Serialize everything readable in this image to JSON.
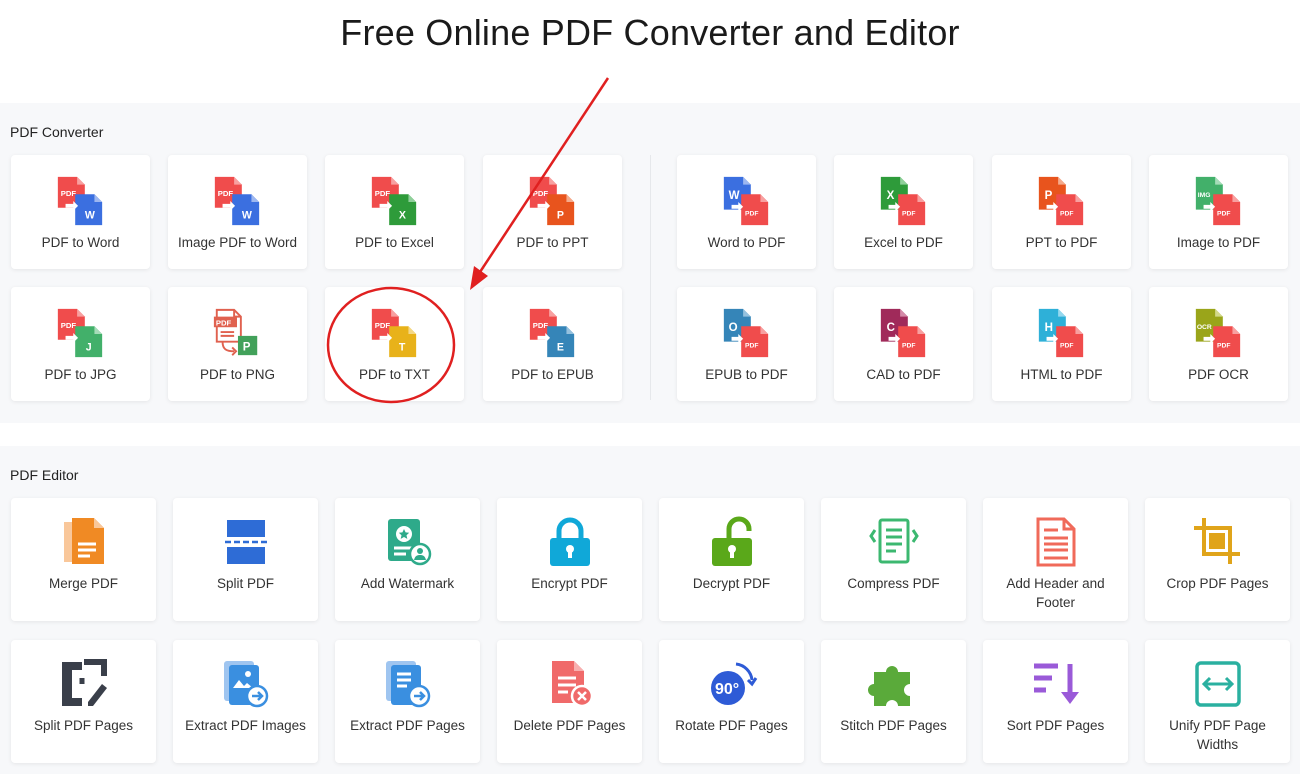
{
  "page": {
    "title": "Free Online PDF Converter and Editor"
  },
  "converter": {
    "label": "PDF Converter",
    "left_row1": [
      "PDF to Word",
      "Image PDF to Word",
      "PDF to Excel",
      "PDF to PPT"
    ],
    "left_row2": [
      "PDF to JPG",
      "PDF to PNG",
      "PDF to TXT",
      "PDF to EPUB"
    ],
    "right_row1": [
      "Word to PDF",
      "Excel to PDF",
      "PPT to PDF",
      "Image to PDF"
    ],
    "right_row2": [
      "EPUB to PDF",
      "CAD to PDF",
      "HTML to PDF",
      "PDF OCR"
    ]
  },
  "editor": {
    "label": "PDF Editor",
    "row1": [
      "Merge PDF",
      "Split PDF",
      "Add Watermark",
      "Encrypt PDF",
      "Decrypt PDF",
      "Compress PDF",
      "Add Header and Footer",
      "Crop PDF Pages"
    ],
    "row2": [
      "Split PDF Pages",
      "Extract PDF Images",
      "Extract PDF Pages",
      "Delete PDF Pages",
      "Rotate PDF Pages",
      "Stitch PDF Pages",
      "Sort PDF Pages",
      "Unify PDF Page Widths"
    ]
  },
  "icon_text": {
    "pdf": "PDF",
    "w": "W",
    "x": "X",
    "p": "P",
    "j": "J",
    "t": "T",
    "e": "E",
    "o": "O",
    "c": "C",
    "h": "H",
    "img": "IMG",
    "ocr": "OCR",
    "ninety": "90°"
  },
  "colors": {
    "pdf_red": "#f04c4c",
    "word_blue": "#3b6fe0",
    "excel_green": "#2e9b3a",
    "ppt_orange": "#e8541d",
    "jpg_green": "#42b06a",
    "txt_yellow": "#e8b21a",
    "epub_teal": "#3585b8",
    "annotation_red": "#e02020"
  },
  "annotation": {
    "highlighted": "PDF to TXT"
  }
}
